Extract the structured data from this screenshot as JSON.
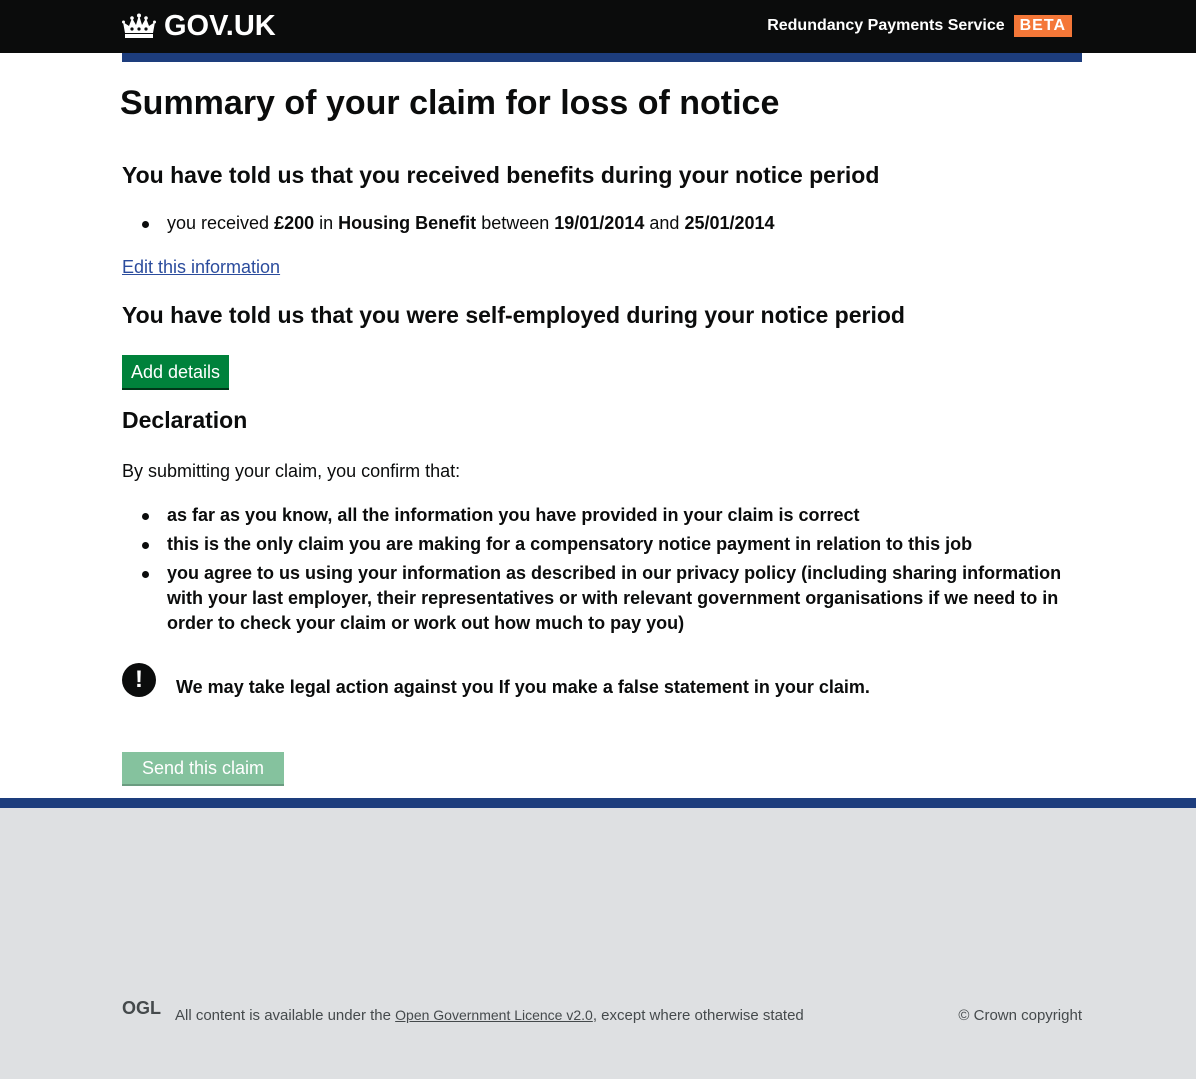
{
  "header": {
    "logo_text": "GOV.UK",
    "service_name": "Redundancy Payments Service",
    "phase_tag": "BETA"
  },
  "main": {
    "title": "Summary of your claim for loss of notice",
    "benefits_section": {
      "heading": "You have told us that you received benefits during your notice period",
      "item": {
        "prefix": "you received",
        "amount": "£200",
        "in_text": "in",
        "benefit": "Housing Benefit",
        "between_text": "between",
        "start_date": "19/01/2014",
        "and_text": "and",
        "end_date": "25/01/2014"
      },
      "edit_link": "Edit this information"
    },
    "self_employed_section": {
      "heading": "You have told us that you were self-employed during your notice period",
      "add_button": "Add details"
    },
    "declaration": {
      "heading": "Declaration",
      "intro": "By submitting your claim, you confirm that:",
      "items": [
        "as far as you know, all the information you have provided in your claim is correct",
        "this is the only claim you are making for a compensatory notice payment in relation to this job",
        "you agree to us using your information as described in our privacy policy (including sharing information with your last employer, their representatives or with relevant government organisations if we need to in order to check your claim or work out how much to pay you)"
      ]
    },
    "warning": {
      "icon": "!",
      "text": "We may take legal action against you If you make a false statement in your claim."
    },
    "send_button": "Send this claim"
  },
  "footer": {
    "licence_prefix": "All content is available under the",
    "licence_link": "Open Government Licence v2.0",
    "licence_suffix": ", except where otherwise stated",
    "ogl_logo": "OGL",
    "copyright": "© Crown copyright"
  },
  "colors": {
    "header_bg": "#0b0c0c",
    "beta_tag": "#f47738",
    "blue_bar": "#1d3d7d",
    "button_green": "#00823b",
    "button_disabled": "#85c29e",
    "link": "#2b4c9d",
    "footer_bg": "#dee0e2"
  }
}
